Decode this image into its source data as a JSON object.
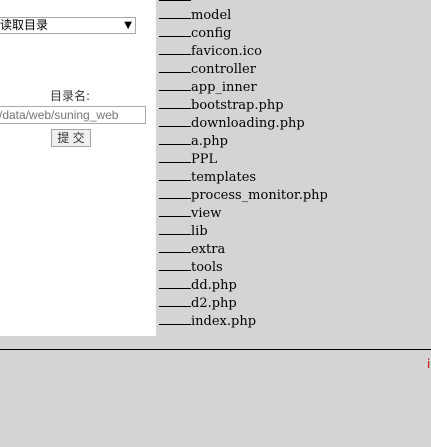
{
  "form": {
    "select_value": "读取目录",
    "dir_label": "目录名:",
    "dir_input_value": "/data/web/suning_web",
    "submit_label": "提 交"
  },
  "file_list": [
    "",
    "model",
    "config",
    "favicon.ico",
    "controller",
    "app_inner",
    "bootstrap.php",
    "downloading.php",
    "a.php",
    "PPL",
    "templates",
    "process_monitor.php",
    "view",
    "lib",
    "extra",
    "tools",
    "dd.php",
    "d2.php",
    "index.php",
    "..."
  ],
  "status_mark": "i"
}
